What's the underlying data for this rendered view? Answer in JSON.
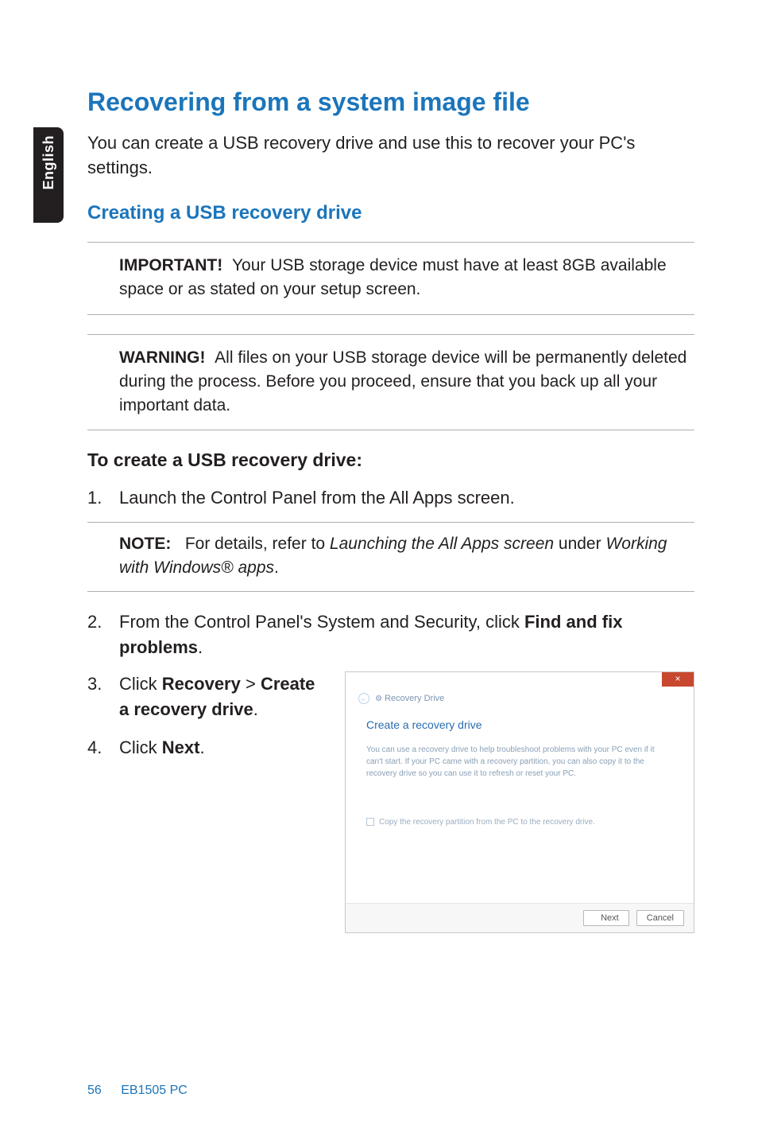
{
  "side_label": "English",
  "title": "Recovering from a system image file",
  "intro": "You can create a USB recovery drive and use this to recover your PC's settings.",
  "sub_heading": "Creating a USB recovery drive",
  "important": {
    "label": "IMPORTANT!",
    "text": "Your USB storage device must have at least 8GB available space or as stated on your setup screen."
  },
  "warning": {
    "label": "WARNING!",
    "text": "All files on your USB storage device will be permanently deleted during the process. Before you proceed, ensure that you back up all your important data."
  },
  "step_header": "To create a USB recovery drive:",
  "steps": {
    "s1": {
      "num": "1.",
      "text": "Launch the Control Panel from the All Apps screen."
    },
    "s2": {
      "num": "2.",
      "pre": "From the Control Panel's System and Security, click ",
      "bold": "Find and fix problems",
      "post": "."
    },
    "s3": {
      "num": "3.",
      "pre": "Click ",
      "b1": "Recovery",
      "mid": " > ",
      "b2": "Create a recovery drive",
      "post": "."
    },
    "s4": {
      "num": "4.",
      "pre": "Click ",
      "b1": "Next",
      "post": "."
    }
  },
  "note": {
    "label": "NOTE:",
    "pre": "For details, refer to ",
    "ital1": "Launching the All Apps screen",
    "mid": " under ",
    "ital2": "Working with Windows® apps",
    "post": "."
  },
  "dialog": {
    "crumb": "Recovery Drive",
    "heading": "Create a recovery drive",
    "body": "You can use a recovery drive to help troubleshoot problems with your PC even if it can't start. If your PC came with a recovery partition, you can also copy it to the recovery drive so you can use it to refresh or reset your PC.",
    "checkbox": "Copy the recovery partition from the PC to the recovery drive.",
    "btn_next": "Next",
    "btn_cancel": "Cancel"
  },
  "footer": {
    "page": "56",
    "title": "EB1505 PC"
  }
}
